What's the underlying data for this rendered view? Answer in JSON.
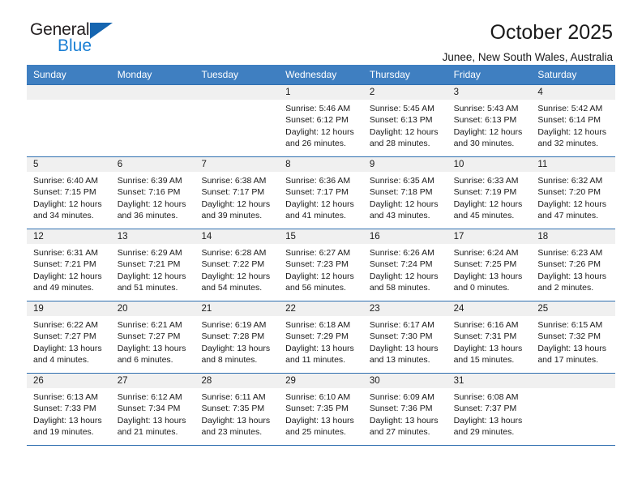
{
  "brand": {
    "name_part1": "General",
    "name_part2": "Blue",
    "accent_color": "#1a7fd4"
  },
  "header": {
    "title": "October 2025",
    "subtitle": "Junee, New South Wales, Australia"
  },
  "calendar": {
    "header_bg": "#3f7fc1",
    "weekdays": [
      "Sunday",
      "Monday",
      "Tuesday",
      "Wednesday",
      "Thursday",
      "Friday",
      "Saturday"
    ],
    "weeks": [
      [
        {
          "day": "",
          "sunrise": "",
          "sunset": "",
          "daylight_line1": "",
          "daylight_line2": ""
        },
        {
          "day": "",
          "sunrise": "",
          "sunset": "",
          "daylight_line1": "",
          "daylight_line2": ""
        },
        {
          "day": "",
          "sunrise": "",
          "sunset": "",
          "daylight_line1": "",
          "daylight_line2": ""
        },
        {
          "day": "1",
          "sunrise": "Sunrise: 5:46 AM",
          "sunset": "Sunset: 6:12 PM",
          "daylight_line1": "Daylight: 12 hours",
          "daylight_line2": "and 26 minutes."
        },
        {
          "day": "2",
          "sunrise": "Sunrise: 5:45 AM",
          "sunset": "Sunset: 6:13 PM",
          "daylight_line1": "Daylight: 12 hours",
          "daylight_line2": "and 28 minutes."
        },
        {
          "day": "3",
          "sunrise": "Sunrise: 5:43 AM",
          "sunset": "Sunset: 6:13 PM",
          "daylight_line1": "Daylight: 12 hours",
          "daylight_line2": "and 30 minutes."
        },
        {
          "day": "4",
          "sunrise": "Sunrise: 5:42 AM",
          "sunset": "Sunset: 6:14 PM",
          "daylight_line1": "Daylight: 12 hours",
          "daylight_line2": "and 32 minutes."
        }
      ],
      [
        {
          "day": "5",
          "sunrise": "Sunrise: 6:40 AM",
          "sunset": "Sunset: 7:15 PM",
          "daylight_line1": "Daylight: 12 hours",
          "daylight_line2": "and 34 minutes."
        },
        {
          "day": "6",
          "sunrise": "Sunrise: 6:39 AM",
          "sunset": "Sunset: 7:16 PM",
          "daylight_line1": "Daylight: 12 hours",
          "daylight_line2": "and 36 minutes."
        },
        {
          "day": "7",
          "sunrise": "Sunrise: 6:38 AM",
          "sunset": "Sunset: 7:17 PM",
          "daylight_line1": "Daylight: 12 hours",
          "daylight_line2": "and 39 minutes."
        },
        {
          "day": "8",
          "sunrise": "Sunrise: 6:36 AM",
          "sunset": "Sunset: 7:17 PM",
          "daylight_line1": "Daylight: 12 hours",
          "daylight_line2": "and 41 minutes."
        },
        {
          "day": "9",
          "sunrise": "Sunrise: 6:35 AM",
          "sunset": "Sunset: 7:18 PM",
          "daylight_line1": "Daylight: 12 hours",
          "daylight_line2": "and 43 minutes."
        },
        {
          "day": "10",
          "sunrise": "Sunrise: 6:33 AM",
          "sunset": "Sunset: 7:19 PM",
          "daylight_line1": "Daylight: 12 hours",
          "daylight_line2": "and 45 minutes."
        },
        {
          "day": "11",
          "sunrise": "Sunrise: 6:32 AM",
          "sunset": "Sunset: 7:20 PM",
          "daylight_line1": "Daylight: 12 hours",
          "daylight_line2": "and 47 minutes."
        }
      ],
      [
        {
          "day": "12",
          "sunrise": "Sunrise: 6:31 AM",
          "sunset": "Sunset: 7:21 PM",
          "daylight_line1": "Daylight: 12 hours",
          "daylight_line2": "and 49 minutes."
        },
        {
          "day": "13",
          "sunrise": "Sunrise: 6:29 AM",
          "sunset": "Sunset: 7:21 PM",
          "daylight_line1": "Daylight: 12 hours",
          "daylight_line2": "and 51 minutes."
        },
        {
          "day": "14",
          "sunrise": "Sunrise: 6:28 AM",
          "sunset": "Sunset: 7:22 PM",
          "daylight_line1": "Daylight: 12 hours",
          "daylight_line2": "and 54 minutes."
        },
        {
          "day": "15",
          "sunrise": "Sunrise: 6:27 AM",
          "sunset": "Sunset: 7:23 PM",
          "daylight_line1": "Daylight: 12 hours",
          "daylight_line2": "and 56 minutes."
        },
        {
          "day": "16",
          "sunrise": "Sunrise: 6:26 AM",
          "sunset": "Sunset: 7:24 PM",
          "daylight_line1": "Daylight: 12 hours",
          "daylight_line2": "and 58 minutes."
        },
        {
          "day": "17",
          "sunrise": "Sunrise: 6:24 AM",
          "sunset": "Sunset: 7:25 PM",
          "daylight_line1": "Daylight: 13 hours",
          "daylight_line2": "and 0 minutes."
        },
        {
          "day": "18",
          "sunrise": "Sunrise: 6:23 AM",
          "sunset": "Sunset: 7:26 PM",
          "daylight_line1": "Daylight: 13 hours",
          "daylight_line2": "and 2 minutes."
        }
      ],
      [
        {
          "day": "19",
          "sunrise": "Sunrise: 6:22 AM",
          "sunset": "Sunset: 7:27 PM",
          "daylight_line1": "Daylight: 13 hours",
          "daylight_line2": "and 4 minutes."
        },
        {
          "day": "20",
          "sunrise": "Sunrise: 6:21 AM",
          "sunset": "Sunset: 7:27 PM",
          "daylight_line1": "Daylight: 13 hours",
          "daylight_line2": "and 6 minutes."
        },
        {
          "day": "21",
          "sunrise": "Sunrise: 6:19 AM",
          "sunset": "Sunset: 7:28 PM",
          "daylight_line1": "Daylight: 13 hours",
          "daylight_line2": "and 8 minutes."
        },
        {
          "day": "22",
          "sunrise": "Sunrise: 6:18 AM",
          "sunset": "Sunset: 7:29 PM",
          "daylight_line1": "Daylight: 13 hours",
          "daylight_line2": "and 11 minutes."
        },
        {
          "day": "23",
          "sunrise": "Sunrise: 6:17 AM",
          "sunset": "Sunset: 7:30 PM",
          "daylight_line1": "Daylight: 13 hours",
          "daylight_line2": "and 13 minutes."
        },
        {
          "day": "24",
          "sunrise": "Sunrise: 6:16 AM",
          "sunset": "Sunset: 7:31 PM",
          "daylight_line1": "Daylight: 13 hours",
          "daylight_line2": "and 15 minutes."
        },
        {
          "day": "25",
          "sunrise": "Sunrise: 6:15 AM",
          "sunset": "Sunset: 7:32 PM",
          "daylight_line1": "Daylight: 13 hours",
          "daylight_line2": "and 17 minutes."
        }
      ],
      [
        {
          "day": "26",
          "sunrise": "Sunrise: 6:13 AM",
          "sunset": "Sunset: 7:33 PM",
          "daylight_line1": "Daylight: 13 hours",
          "daylight_line2": "and 19 minutes."
        },
        {
          "day": "27",
          "sunrise": "Sunrise: 6:12 AM",
          "sunset": "Sunset: 7:34 PM",
          "daylight_line1": "Daylight: 13 hours",
          "daylight_line2": "and 21 minutes."
        },
        {
          "day": "28",
          "sunrise": "Sunrise: 6:11 AM",
          "sunset": "Sunset: 7:35 PM",
          "daylight_line1": "Daylight: 13 hours",
          "daylight_line2": "and 23 minutes."
        },
        {
          "day": "29",
          "sunrise": "Sunrise: 6:10 AM",
          "sunset": "Sunset: 7:35 PM",
          "daylight_line1": "Daylight: 13 hours",
          "daylight_line2": "and 25 minutes."
        },
        {
          "day": "30",
          "sunrise": "Sunrise: 6:09 AM",
          "sunset": "Sunset: 7:36 PM",
          "daylight_line1": "Daylight: 13 hours",
          "daylight_line2": "and 27 minutes."
        },
        {
          "day": "31",
          "sunrise": "Sunrise: 6:08 AM",
          "sunset": "Sunset: 7:37 PM",
          "daylight_line1": "Daylight: 13 hours",
          "daylight_line2": "and 29 minutes."
        },
        {
          "day": "",
          "sunrise": "",
          "sunset": "",
          "daylight_line1": "",
          "daylight_line2": ""
        }
      ]
    ]
  }
}
